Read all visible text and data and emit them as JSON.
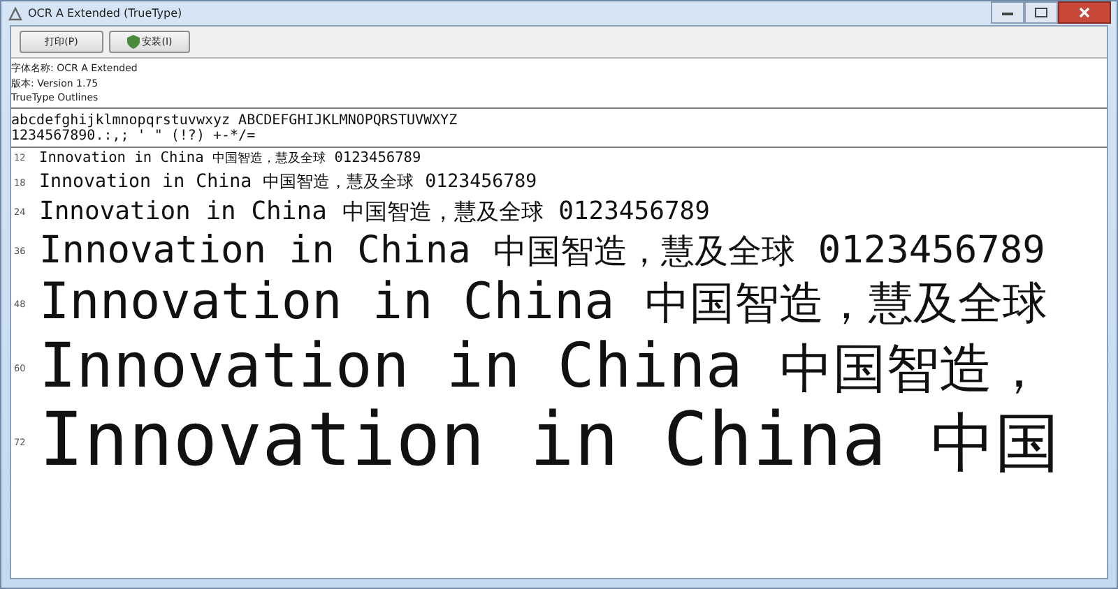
{
  "window": {
    "title": "OCR A Extended (TrueType)"
  },
  "toolbar": {
    "buttons": [
      "打印(P)",
      "安装(I)"
    ]
  },
  "info": [
    "字体名称: OCR A Extended",
    "版本: Version 1.75",
    "TrueType Outlines"
  ],
  "charset": [
    "abcdefghijklmnopqrstuvwxyz ABCDEFGHIJKLMNOPQRSTUVWXYZ",
    "1234567890.:,; ' \" (!?) +-*/="
  ],
  "samples": [
    {
      "size": "12",
      "latin": "Innovation in China",
      "cjk": "中国智造，慧及全球",
      "digits": "0123456789"
    },
    {
      "size": "18",
      "latin": "Innovation in China",
      "cjk": "中国智造，慧及全球",
      "digits": "0123456789"
    },
    {
      "size": "24",
      "latin": "Innovation in China",
      "cjk": "中国智造，慧及全球",
      "digits": "0123456789"
    },
    {
      "size": "36",
      "latin": "Innovation in China",
      "cjk": "中国智造，慧及全球",
      "digits": "0123456789"
    },
    {
      "size": "48",
      "latin": "Innovation in China",
      "cjk": "中国智造，慧及全球"
    },
    {
      "size": "60",
      "latin": "Innovation in China",
      "cjk": "中国智造，"
    },
    {
      "size": "72",
      "latin": "Innovation in China",
      "cjk": "中国"
    }
  ]
}
